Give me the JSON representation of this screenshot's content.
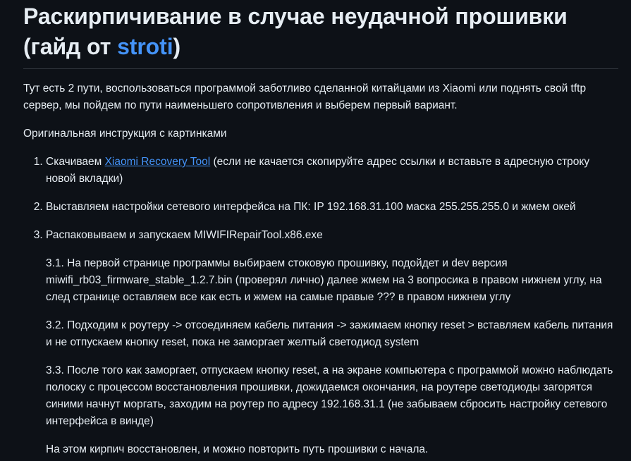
{
  "title_prefix": "Раскирпичивание в случае неудачной прошивки (гайд от ",
  "title_author": "stroti",
  "title_suffix": ")",
  "intro": "Тут есть 2 пути, воспользоваться программой заботливо сделанной китайцами из Xiaomi или поднять свой tftp сервер, мы пойдем по пути наименьшего сопротивления и выберем первый вариант.",
  "original_instruction": "Оригинальная инструкция с картинками",
  "steps": {
    "s1_prefix": "Скачиваем ",
    "s1_link": "Xiaomi Recovery Tool",
    "s1_suffix": " (если не качается скопируйте адрес ссылки и вставьте в адресную строку новой вкладки)",
    "s2": "Выставляем настройки сетевого интерфейса на ПК: IP 192.168.31.100 маска 255.255.255.0 и жмем окей",
    "s3": "Распаковываем и запускаем MIWIFIRepairTool.x86.exe",
    "s3_1": "3.1. На первой странице программы выбираем стоковую прошивку, подойдет и dev версия miwifi_rb03_firmware_stable_1.2.7.bin (проверял лично) далее жмем на 3 вопросика в правом нижнем углу, на след странице оставляем все как есть и жмем на самые правые ??? в правом нижнем углу",
    "s3_2": "3.2. Подходим к роутеру -> отсоединяем кабель питания -> зажимаем кнопку reset > вставляем кабель питания и не отпускаем кнопку reset, пока не заморгает желтый светодиод system",
    "s3_3": "3.3. После того как заморгает, отпускаем кнопку reset, а на экране компьютера с программой можно наблюдать полоску с процессом восстановления прошивки, дожидаемся окончания, на роутере светодиоды загорятся синими начнут моргать, заходим на роутер по адресу 192.168.31.1 (не забываем сбросить настройку сетевого интерфейса в винде)",
    "s3_end": "На этом кирпич восстановлен, и можно повторить путь прошивки с начала."
  },
  "colors": {
    "background": "#0d1117",
    "text": "#e6edf3",
    "link": "#4493f8",
    "divider": "#30363d"
  }
}
